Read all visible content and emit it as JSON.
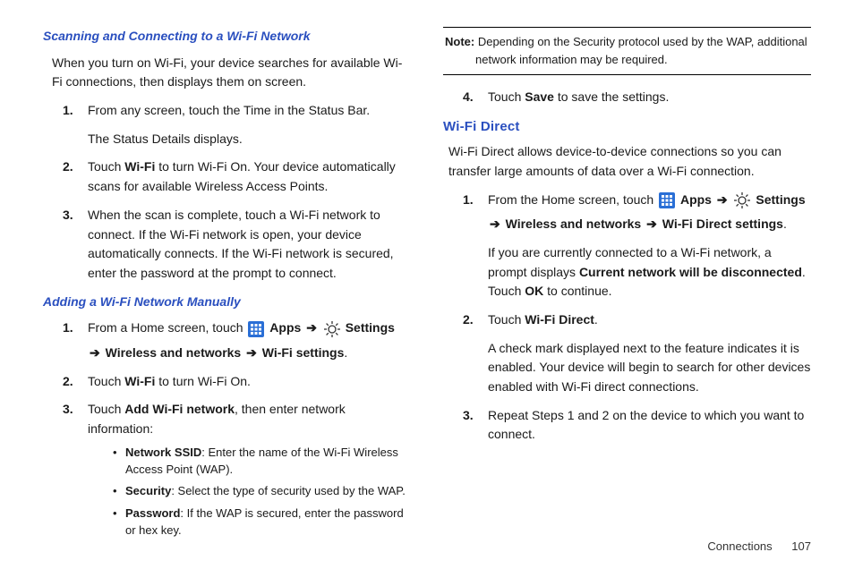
{
  "left": {
    "h1": "Scanning and Connecting to a Wi-Fi Network",
    "intro": "When you turn on Wi-Fi, your device searches for available Wi-Fi connections, then displays them on screen.",
    "steps": [
      {
        "n": "1.",
        "p1": "From any screen, touch the Time in the Status Bar.",
        "p2": "The Status Details displays."
      },
      {
        "n": "2.",
        "p1_pre": "Touch ",
        "p1_b": "Wi-Fi",
        "p1_post": " to turn Wi-Fi On. Your device automatically scans for available Wireless Access Points."
      },
      {
        "n": "3.",
        "p1": "When the scan is complete, touch a Wi-Fi network to connect. If the Wi-Fi network is open, your device automatically connects. If the Wi-Fi network is secured, enter the password at the prompt to connect."
      }
    ],
    "h2": "Adding a Wi-Fi Network Manually",
    "steps2": [
      {
        "n": "1.",
        "pre": "From a Home screen, touch ",
        "apps": "Apps",
        "settings": "Settings",
        "line2_pre": "",
        "wn": "Wireless and networks",
        "wfs": "Wi-Fi settings",
        "period": "."
      },
      {
        "n": "2.",
        "pre": "Touch ",
        "b": "Wi-Fi",
        "post": " to turn Wi-Fi On."
      },
      {
        "n": "3.",
        "pre": "Touch ",
        "b": "Add Wi-Fi network",
        "post": ", then enter network information:"
      }
    ],
    "bullets": [
      {
        "b": "Network SSID",
        "t": ": Enter the name of the Wi-Fi Wireless Access Point (WAP)."
      },
      {
        "b": "Security",
        "t": ": Select the type of security used by the WAP."
      },
      {
        "b": "Password",
        "t": ": If the WAP is secured, enter the password or hex key."
      }
    ]
  },
  "right": {
    "note_b": "Note:",
    "note_t": " Depending on the Security protocol used by the WAP, additional",
    "note_t2": "network information may be required.",
    "step4": {
      "n": "4.",
      "pre": "Touch ",
      "b": "Save",
      "post": " to save the settings."
    },
    "h": "Wi-Fi Direct",
    "intro": "Wi-Fi Direct allows device-to-device connections so you can transfer large amounts of data over a Wi-Fi connection.",
    "steps": [
      {
        "n": "1.",
        "pre": "From the Home screen, touch ",
        "apps": "Apps",
        "settings": "Settings",
        "wn": "Wireless and networks",
        "wfds": "Wi-Fi Direct settings",
        "period": ".",
        "p2_pre": "If you are currently connected to a Wi-Fi network, a prompt displays ",
        "p2_b": "Current network will be disconnected",
        "p2_mid": ". Touch ",
        "p2_b2": "OK",
        "p2_post": " to continue."
      },
      {
        "n": "2.",
        "pre": "Touch ",
        "b": "Wi-Fi Direct",
        "post": ".",
        "p2": "A check mark displayed next to the feature indicates it is enabled. Your device will begin to search for other devices enabled with Wi-Fi direct connections."
      },
      {
        "n": "3.",
        "p1": "Repeat Steps 1 and 2 on the device to which you want to connect."
      }
    ]
  },
  "footer": {
    "section": "Connections",
    "page": "107"
  }
}
